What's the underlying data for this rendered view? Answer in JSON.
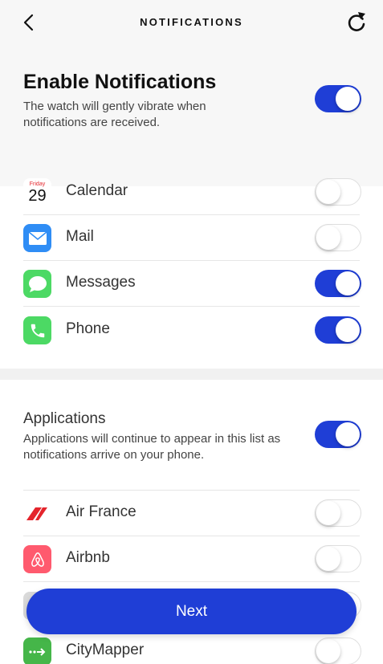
{
  "nav": {
    "title": "NOTIFICATIONS",
    "back_icon": "chevron-left-icon",
    "refresh_icon": "refresh-icon"
  },
  "enable": {
    "title": "Enable Notifications",
    "description": "The watch will gently vibrate when notifications are received.",
    "enabled": true
  },
  "system_apps": [
    {
      "label": "Calendar",
      "icon": "calendar-icon",
      "enabled": false,
      "calendar_day": "Friday",
      "calendar_date": "29"
    },
    {
      "label": "Mail",
      "icon": "mail-icon",
      "enabled": false
    },
    {
      "label": "Messages",
      "icon": "messages-icon",
      "enabled": true
    },
    {
      "label": "Phone",
      "icon": "phone-icon",
      "enabled": true
    }
  ],
  "applications": {
    "title": "Applications",
    "description": "Applications will continue to appear in this list as notifications arrive on your phone.",
    "enabled": true,
    "items": [
      {
        "label": "Air France",
        "icon": "air-france-icon",
        "enabled": false
      },
      {
        "label": "Airbnb",
        "icon": "airbnb-icon",
        "enabled": false
      },
      {
        "label": "CityMapper",
        "icon": "citymapper-icon",
        "enabled": false
      }
    ]
  },
  "next_button": {
    "label": "Next"
  },
  "colors": {
    "accent": "#1f3ed6",
    "header_bg": "#f7f7f7",
    "mail_icon": "#2f8df5",
    "messages_icon": "#4cd964",
    "phone_icon": "#4cd964",
    "air_france_red": "#e4252c",
    "airbnb_icon": "#ff5a6e",
    "citymapper_icon": "#45b649"
  }
}
